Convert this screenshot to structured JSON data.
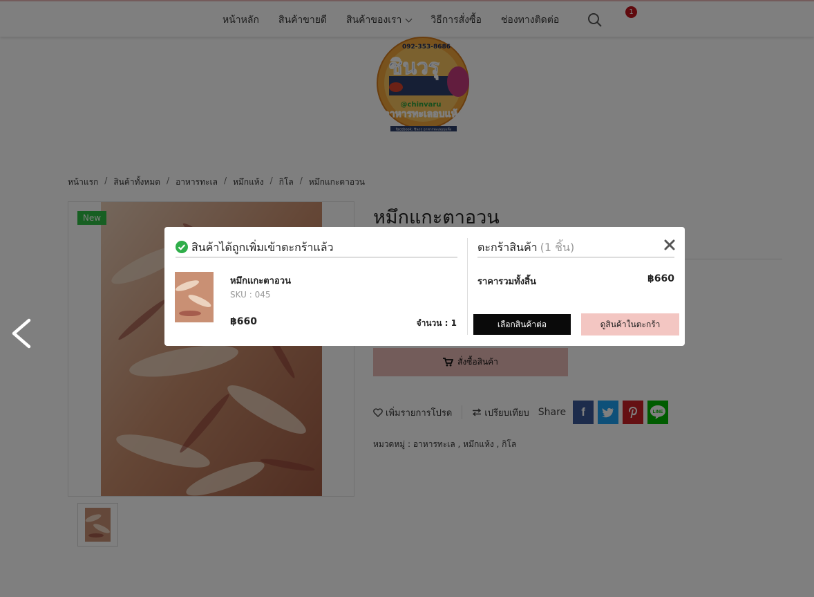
{
  "nav": {
    "items": [
      "หน้าหลัก",
      "สินค้าขายดี",
      "สินค้าของเรา",
      "วิธีการสั่งซื้อ",
      "ช่องทางติดต่อ"
    ],
    "cart_count": "1"
  },
  "logo": {
    "phone": "092-353-8686",
    "brand": "ชินวรุ",
    "line_id": "@chinvaru",
    "tagline": "อาหารทะเลอบแห้ง",
    "facebook": "facebook: ชินวรุ อาหารทะเลอบแห้ง"
  },
  "breadcrumb": [
    "หน้าแรก",
    "สินค้าทั้งหมด",
    "อาหารทะเล",
    "หมึกแห้ง",
    "กิโล",
    "หมึกแกะตาอวน"
  ],
  "product": {
    "badge": "New",
    "title": "หมึกแกะตาอวน",
    "order_button": "สั่งซื้อสินค้า",
    "wishlist": "เพิ่มรายการโปรด",
    "compare": "เปรียบเทียบ",
    "share_label": "Share",
    "social": {
      "facebook_glyph": "f",
      "line_label": "LINE"
    },
    "categories": "หมวดหมู่ : อาหารทะเล ,  หมึกแห้ง ,  กิโล"
  },
  "modal": {
    "added_title": "สินค้าได้ถูกเพิ่มเข้าตะกร้าแล้ว",
    "item_name": "หมึกแกะตาอวน",
    "sku": "SKU : 045",
    "price": "฿660",
    "quantity": "จำนวน : 1",
    "cart_title": "ตะกร้าสินค้า",
    "cart_count": "(1 ชิ้น)",
    "total_label": "ราคารวมทั้งสิ้น",
    "total_value": "฿660",
    "continue_button": "เลือกสินค้าต่อ",
    "view_cart_button": "ดูสินค้าในตะกร้า"
  },
  "colors": {
    "badge_new": "#2fbf44",
    "order_button": "#e7b9b5",
    "view_cart": "#f3c6c2",
    "cart_badge": "#c0151d",
    "facebook": "#3b5998",
    "twitter": "#1da1f2",
    "pinterest": "#cb2027",
    "line": "#00b900"
  }
}
